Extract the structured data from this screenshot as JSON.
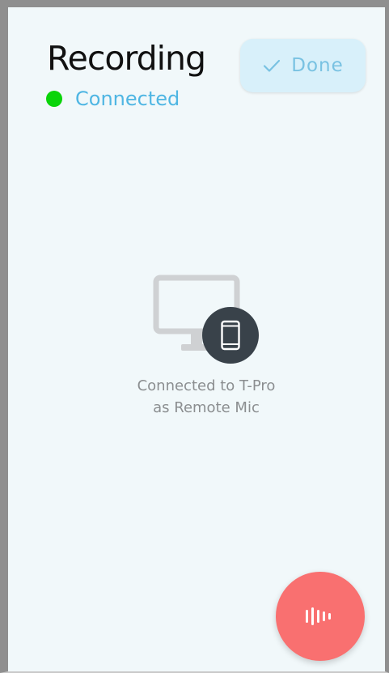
{
  "header": {
    "title": "Recording",
    "status_text": "Connected",
    "status_color": "#0ad40a",
    "done_label": "Done",
    "done_icon": "checkmark-icon"
  },
  "main": {
    "caption_line1": "Connected to T-Pro",
    "caption_line2": "as Remote Mic",
    "graphic_icons": [
      "monitor-icon",
      "smartphone-icon"
    ]
  },
  "fab": {
    "icon": "audio-waveform-icon",
    "color": "#f97070"
  },
  "colors": {
    "background": "#f1f8fa",
    "accent": "#4fb6e3",
    "done_button_bg": "#d8f0fa",
    "phone_badge": "#39424a"
  }
}
